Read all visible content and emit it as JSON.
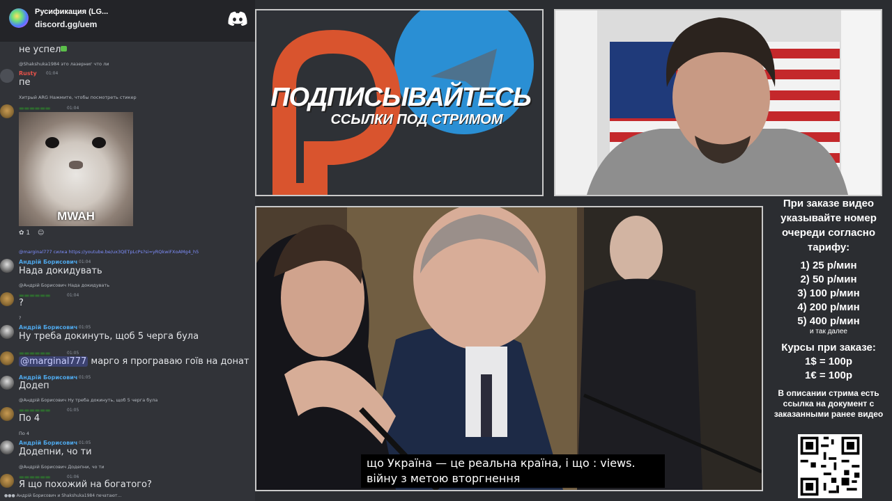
{
  "discord": {
    "server_name": "Русификация (LG...",
    "invite": "discord.gg/uem",
    "typing": "Андрій Борисович и Shakshuka1984 печатают..."
  },
  "messages": {
    "m0": {
      "text": "не успел"
    },
    "m1": {
      "reply": "@Shakshuka1984 это лазерниг что ли",
      "name": "Rusty",
      "time": "01:04",
      "text": "пе"
    },
    "m2": {
      "reply": "Хитрый  ARG  Нажмите, чтобы посмотреть стикер",
      "time": "01:04",
      "sticker_caption": "MWAH",
      "reaction_count": "1"
    },
    "m3": {
      "reply": "@marginal777 силка https://youtube.be/ux3QETpLcPs?si=yRQkwiFXoAMg4_h5",
      "name": "Андрій Борисович",
      "time": "01:04",
      "text": "Нада докидувать"
    },
    "m4": {
      "reply": "@Андрій Борисович Нада докидувать",
      "time": "01:04",
      "text": "?"
    },
    "m5": {
      "reply": "?",
      "name": "Андрій Борисович",
      "time": "01:05",
      "text": "Ну треба докинуть, щоб 5 черга була"
    },
    "m6": {
      "time": "01:05",
      "mention": "@marginal777",
      "text": " марго я програваю гоїв на донат"
    },
    "m7": {
      "name": "Андрій Борисович",
      "time": "01:05",
      "text": "Додеп"
    },
    "m8": {
      "reply": "@Андрій Борисович Ну треба докинуть, щоб 5 черга була",
      "time": "01:05",
      "text": "По 4"
    },
    "m9": {
      "reply": "По 4",
      "name": "Андрій Борисович",
      "time": "01:05",
      "text": "Додепни, чо ти"
    },
    "m10": {
      "reply": "@Андрій Борисович Додепни, чо ти",
      "time": "01:06",
      "text": "Я що похожий на богатого?"
    }
  },
  "promo": {
    "title": "ПОДПИСЫВАЙТЕСЬ",
    "subtitle": "ССЫЛКИ ПОД СТРИМОМ"
  },
  "video": {
    "subtitle_line1": "що Україна — це реальна країна, і що : views.",
    "subtitle_line2": "війну з метою вторгнення"
  },
  "info": {
    "heading": "При заказе видео указывайте номер очереди согласно тарифу:",
    "tiers": [
      "1) 25 р/мин",
      "2) 50 р/мин",
      "3) 100 р/мин",
      "4) 200 р/мин",
      "5) 400 р/мин"
    ],
    "etc": "и так далее",
    "rates_heading": "Курсы при заказе:",
    "rates": [
      "1$ = 100р",
      "1€ = 100р"
    ],
    "note": "В описании стрима есть ссылка на документ с заказанными ранее видео"
  },
  "colors": {
    "name_blue": "#4ea6e8",
    "name_red": "#e8524a",
    "chat_bg": "#313338"
  }
}
